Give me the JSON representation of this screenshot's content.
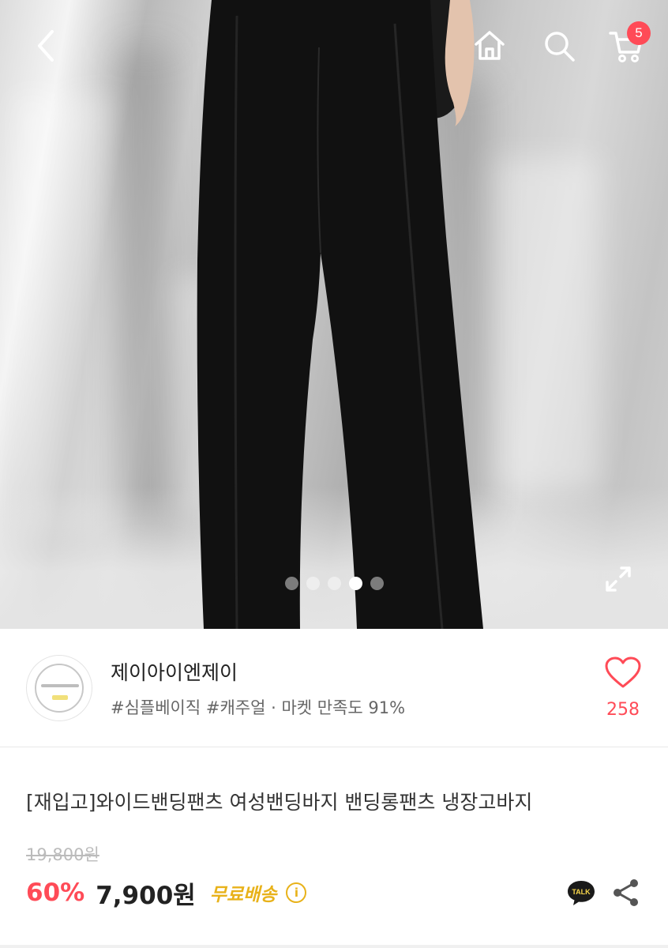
{
  "topbar": {
    "back_icon": "chevron-left-icon",
    "home_icon": "home-icon",
    "search_icon": "search-icon",
    "cart_icon": "cart-icon",
    "cart_count": "5"
  },
  "gallery": {
    "total_images": 5,
    "active_index": 3,
    "expand_icon": "expand-icon"
  },
  "seller": {
    "name": "제이아이엔제이",
    "tags": "#심플베이직 #캐주얼 · 마켓 만족도 91%",
    "like_count": "258",
    "like_icon": "heart-outline-icon"
  },
  "product": {
    "title": "[재입고]와이드밴딩팬츠 여성밴딩바지 밴딩롱팬츠 냉장고바지",
    "original_price": "19,800원",
    "discount": "60%",
    "price": "7,900원",
    "shipping": "무료배송",
    "info_icon_label": "i",
    "talk_label": "TALK"
  },
  "colors": {
    "accent": "#ff4b57",
    "shipping": "#e8b21a"
  }
}
